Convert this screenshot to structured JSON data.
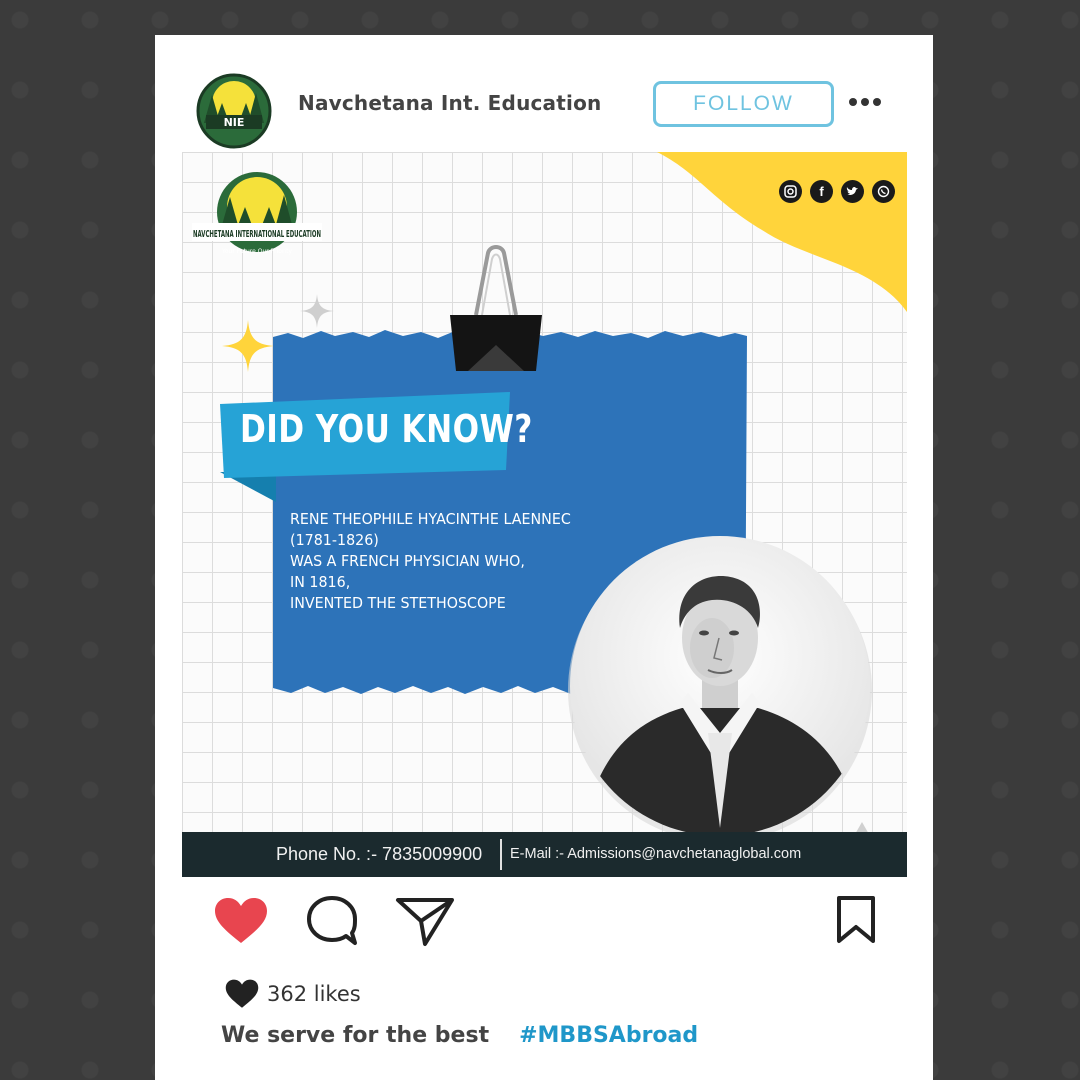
{
  "header": {
    "account_name": "Navchetana Int. Education",
    "avatar_text": "NIE",
    "follow_label": "FOLLOW"
  },
  "post": {
    "brand_logo_text": "NAVCHETANA INTERNATIONAL EDUCATION",
    "brand_tagline": "Your Future Our Priority",
    "headline": "DID YOU KNOW?",
    "fact_lines": [
      "RENE THEOPHILE HYACINTHE LAENNEC",
      "(1781-1826)",
      "WAS A FRENCH PHYSICIAN WHO,",
      "IN 1816,",
      "INVENTED THE STETHOSCOPE"
    ],
    "social_icons": [
      "instagram-icon",
      "facebook-icon",
      "twitter-icon",
      "whatsapp-icon"
    ],
    "contact": {
      "phone": "Phone No. :- 7835009900",
      "email": "E-Mail :- Admissions@navchetanaglobal.com"
    }
  },
  "actions": {
    "liked": true,
    "icons": [
      "heart-icon",
      "comment-icon",
      "share-icon",
      "bookmark-icon"
    ]
  },
  "likes": {
    "text": "362 likes"
  },
  "caption": {
    "text": "We serve for the best",
    "hashtag": "#MBBSAbroad"
  },
  "colors": {
    "background": "#3b3b3b",
    "accent_blue": "#2d73b9",
    "ribbon_blue": "#26a3d6",
    "yellow": "#ffd43b",
    "heart_red": "#e8454f",
    "hashtag": "#1f97c9",
    "follow": "#6fc3e0",
    "contact_bar": "#1b2a2e"
  }
}
